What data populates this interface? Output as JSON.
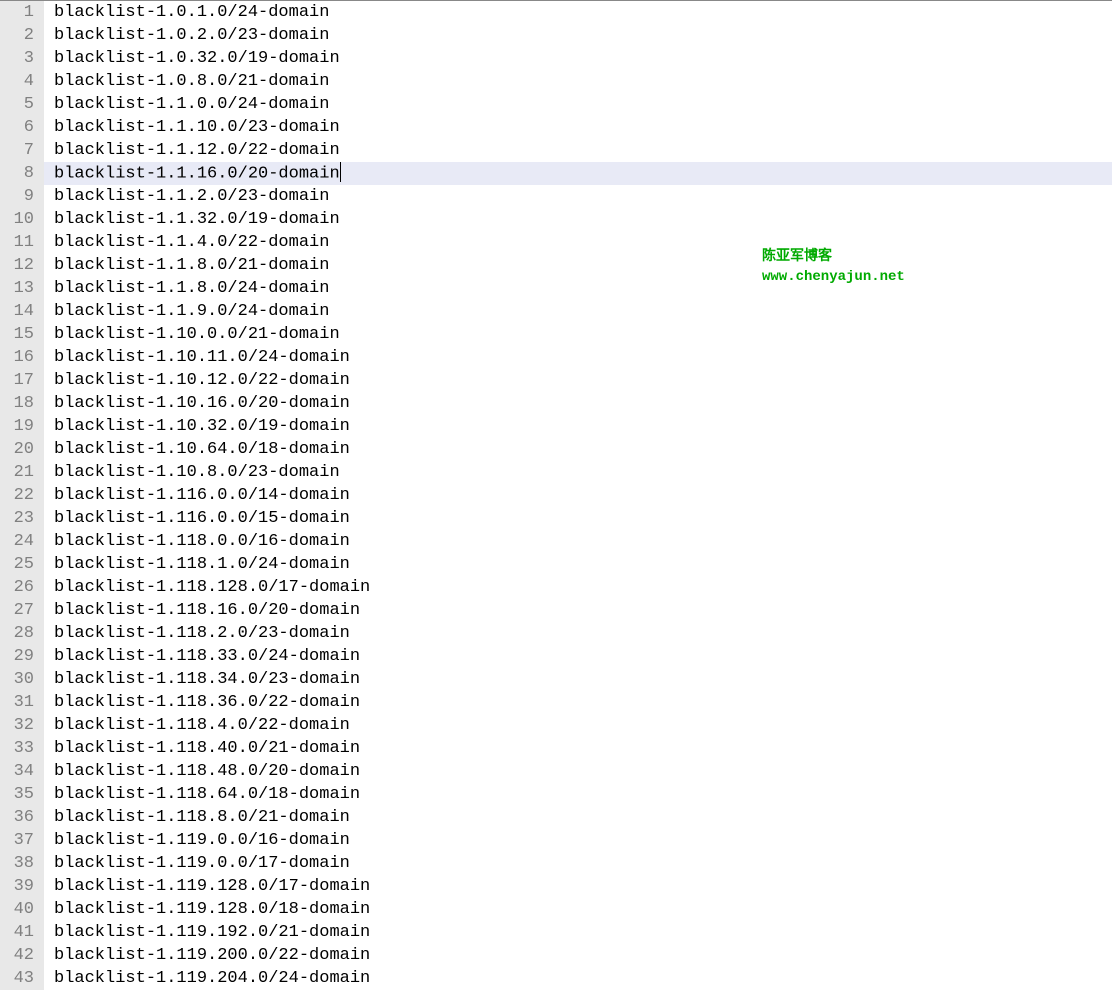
{
  "editor": {
    "highlightedLine": 8,
    "lines": [
      "blacklist-1.0.1.0/24-domain",
      "blacklist-1.0.2.0/23-domain",
      "blacklist-1.0.32.0/19-domain",
      "blacklist-1.0.8.0/21-domain",
      "blacklist-1.1.0.0/24-domain",
      "blacklist-1.1.10.0/23-domain",
      "blacklist-1.1.12.0/22-domain",
      "blacklist-1.1.16.0/20-domain",
      "blacklist-1.1.2.0/23-domain",
      "blacklist-1.1.32.0/19-domain",
      "blacklist-1.1.4.0/22-domain",
      "blacklist-1.1.8.0/21-domain",
      "blacklist-1.1.8.0/24-domain",
      "blacklist-1.1.9.0/24-domain",
      "blacklist-1.10.0.0/21-domain",
      "blacklist-1.10.11.0/24-domain",
      "blacklist-1.10.12.0/22-domain",
      "blacklist-1.10.16.0/20-domain",
      "blacklist-1.10.32.0/19-domain",
      "blacklist-1.10.64.0/18-domain",
      "blacklist-1.10.8.0/23-domain",
      "blacklist-1.116.0.0/14-domain",
      "blacklist-1.116.0.0/15-domain",
      "blacklist-1.118.0.0/16-domain",
      "blacklist-1.118.1.0/24-domain",
      "blacklist-1.118.128.0/17-domain",
      "blacklist-1.118.16.0/20-domain",
      "blacklist-1.118.2.0/23-domain",
      "blacklist-1.118.33.0/24-domain",
      "blacklist-1.118.34.0/23-domain",
      "blacklist-1.118.36.0/22-domain",
      "blacklist-1.118.4.0/22-domain",
      "blacklist-1.118.40.0/21-domain",
      "blacklist-1.118.48.0/20-domain",
      "blacklist-1.118.64.0/18-domain",
      "blacklist-1.118.8.0/21-domain",
      "blacklist-1.119.0.0/16-domain",
      "blacklist-1.119.0.0/17-domain",
      "blacklist-1.119.128.0/17-domain",
      "blacklist-1.119.128.0/18-domain",
      "blacklist-1.119.192.0/21-domain",
      "blacklist-1.119.200.0/22-domain",
      "blacklist-1.119.204.0/24-domain"
    ]
  },
  "watermark": {
    "title": "陈亚军博客",
    "url": "www.chenyajun.net"
  }
}
